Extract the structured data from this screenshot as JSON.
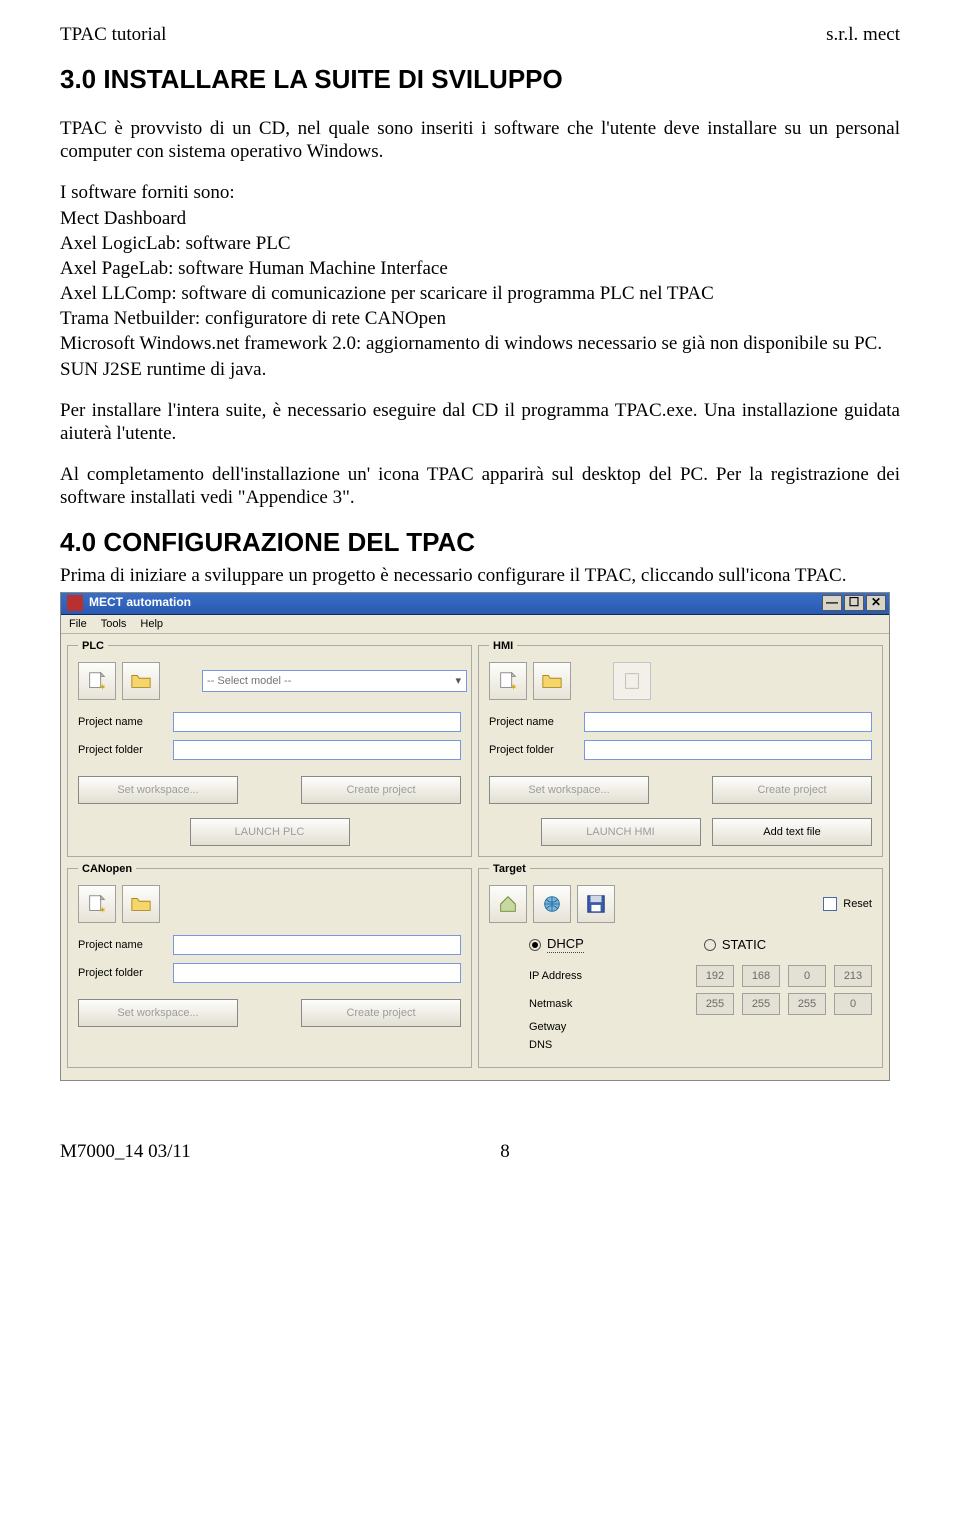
{
  "header": {
    "left": "TPAC   tutorial",
    "right": "s.r.l.  mect"
  },
  "section1": {
    "heading": "3.0 INSTALLARE LA SUITE DI SVILUPPO",
    "p1": "TPAC è provvisto di  un CD, nel quale sono inseriti i software che l'utente deve installare su un personal computer con sistema operativo Windows.",
    "list_intro": "I software forniti sono:",
    "items": [
      "Mect Dashboard",
      "Axel LogicLab: software PLC",
      "Axel PageLab: software Human Machine Interface",
      "Axel LLComp: software di comunicazione per scaricare il programma PLC nel TPAC",
      "Trama Netbuilder: configuratore di rete CANOpen",
      "Microsoft Windows.net framework 2.0: aggiornamento di windows necessario se già non disponibile su PC.",
      "SUN J2SE runtime di java."
    ],
    "p2": "Per installare l'intera suite, è necessario eseguire dal CD il programma TPAC.exe. Una installazione guidata aiuterà l'utente.",
    "p3": "Al completamento dell'installazione un' icona TPAC apparirà sul desktop del PC. Per la registrazione dei software installati vedi \"Appendice 3\"."
  },
  "section2": {
    "heading": "4.0 CONFIGURAZIONE DEL TPAC",
    "p1": "Prima di iniziare a sviluppare un progetto è necessario configurare il TPAC,  cliccando sull'icona TPAC."
  },
  "app": {
    "title": "MECT automation",
    "menus": [
      "File",
      "Tools",
      "Help"
    ],
    "plc": {
      "legend": "PLC",
      "select_placeholder": "-- Select model --",
      "project_name_label": "Project name",
      "project_folder_label": "Project folder",
      "set_workspace": "Set workspace...",
      "create_project": "Create project",
      "launch": "LAUNCH PLC"
    },
    "hmi": {
      "legend": "HMI",
      "project_name_label": "Project name",
      "project_folder_label": "Project folder",
      "set_workspace": "Set workspace...",
      "create_project": "Create project",
      "launch": "LAUNCH HMI",
      "add_text": "Add text file"
    },
    "canopen": {
      "legend": "CANopen",
      "project_name_label": "Project name",
      "project_folder_label": "Project folder",
      "set_workspace": "Set workspace...",
      "create_project": "Create project"
    },
    "target": {
      "legend": "Target",
      "reset": "Reset",
      "dhcp": "DHCP",
      "static": "STATIC",
      "ip_label": "IP Address",
      "ip": [
        "192",
        "168",
        "0",
        "213"
      ],
      "netmask_label": "Netmask",
      "netmask": [
        "255",
        "255",
        "255",
        "0"
      ],
      "getway_label": "Getway",
      "dns_label": "DNS"
    }
  },
  "footer": {
    "left": "M7000_14  03/11",
    "page": "8"
  }
}
